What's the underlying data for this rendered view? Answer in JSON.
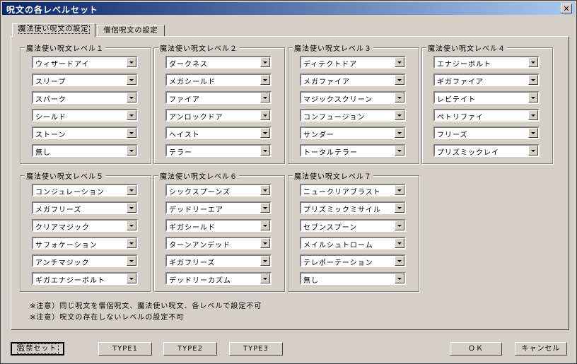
{
  "window": {
    "title": "呪文の各レベルセット"
  },
  "tabs": [
    {
      "label": "魔法使い呪文の設定",
      "active": true
    },
    {
      "label": "僧侶呪文の設定",
      "active": false
    }
  ],
  "groups": [
    {
      "title": "魔法使い呪文レベル１",
      "items": [
        "ウィザードアイ",
        "スリープ",
        "スパーク",
        "シールド",
        "ストーン",
        "無し"
      ]
    },
    {
      "title": "魔法使い呪文レベル２",
      "items": [
        "ダークネス",
        "メガシールド",
        "ファイア",
        "アンロックドア",
        "ヘイスト",
        "テラー"
      ]
    },
    {
      "title": "魔法使い呪文レベル３",
      "items": [
        "ディテクトドア",
        "メガファイア",
        "マジックスクリーン",
        "コンフュージョン",
        "サンダー",
        "トータルテラー"
      ]
    },
    {
      "title": "魔法使い呪文レベル４",
      "items": [
        "エナジーボルト",
        "ギガファイア",
        "レビテイト",
        "ペトリファイ",
        "フリーズ",
        "プリズミックレイ"
      ]
    },
    {
      "title": "魔法使い呪文レベル５",
      "items": [
        "コンジュレーション",
        "メガフリーズ",
        "クリアマジック",
        "サフォケーション",
        "アンチマジック",
        "ギガエナジーボルト"
      ]
    },
    {
      "title": "魔法使い呪文レベル６",
      "items": [
        "シックスプーンズ",
        "デッドリーエア",
        "ギガシールド",
        "ターンアンデッド",
        "ギガフリーズ",
        "デッドリーカズム"
      ]
    },
    {
      "title": "魔法使い呪文レベル７",
      "items": [
        "ニュークリアブラスト",
        "プリズミックミサイル",
        "セブンスプーン",
        "メイルシュトローム",
        "テレポーテーション",
        "無し"
      ]
    }
  ],
  "notes": [
    "※注意）同じ呪文を僧侶呪文、魔法使い呪文、各レベルで設定不可",
    "※注意）呪文の存在しないレベルの設定不可"
  ],
  "buttons": {
    "preset": "監禁セット",
    "type1": "TYPE1",
    "type2": "TYPE2",
    "type3": "TYPE3",
    "ok": "ＯＫ",
    "cancel": "キャンセル"
  }
}
